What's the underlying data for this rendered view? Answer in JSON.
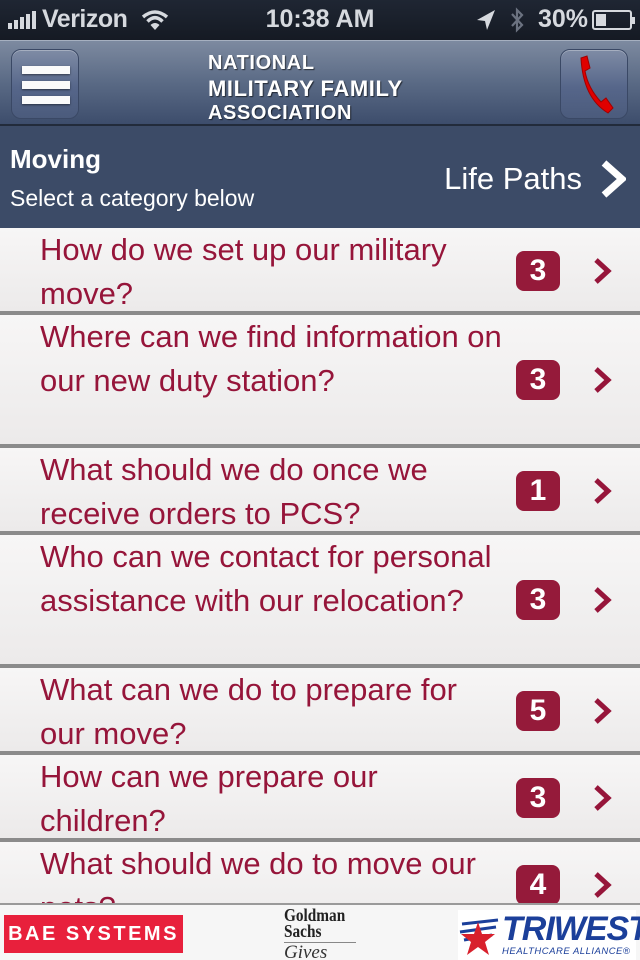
{
  "status_bar": {
    "carrier": "Verizon",
    "time": "10:38 AM",
    "battery_text": "30%",
    "battery_level": 0.3,
    "icons": [
      "signal-icon",
      "wifi-icon",
      "location-icon",
      "bluetooth-icon",
      "battery-icon"
    ]
  },
  "nav": {
    "logo_lines": [
      "NATIONAL",
      "MILITARY FAMILY",
      "ASSOCIATION"
    ],
    "menu_icon": "hamburger-menu-icon",
    "call_icon": "phone-icon",
    "call_icon_color": "#e00000"
  },
  "header": {
    "title": "Moving",
    "subtitle": "Select a category below",
    "life_paths_label": "Life Paths"
  },
  "colors": {
    "accent": "#96153a",
    "badge": "#951a3a",
    "header_bg": "#3c4b67"
  },
  "items": [
    {
      "question": "How do we set up our military move?",
      "count": "3"
    },
    {
      "question": "Where can we find information on our new duty station?",
      "count": "3"
    },
    {
      "question": "What should we do once we receive orders to PCS?",
      "count": "1"
    },
    {
      "question": "Who can we contact for personal assistance with our relocation?",
      "count": "3"
    },
    {
      "question": "What can we do to prepare for our move?",
      "count": "5"
    },
    {
      "question": "How can we prepare our children?",
      "count": "3"
    },
    {
      "question": "What should we do to move our pets?",
      "count": "4"
    }
  ],
  "sponsors": {
    "bae": "BAE SYSTEMS",
    "goldman_line1": "Goldman",
    "goldman_line2": "Sachs",
    "goldman_line3": "Gives",
    "triwest_name": "TRIWEST",
    "triwest_sub": "HEALTHCARE ALLIANCE®"
  }
}
